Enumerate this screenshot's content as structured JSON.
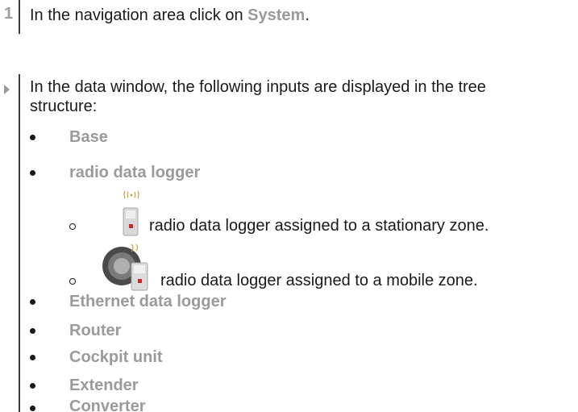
{
  "step": {
    "number": "1",
    "text_before": "In the navigation area click on ",
    "highlight": "System",
    "text_after": "."
  },
  "result": {
    "line1": "In the data window, the following inputs are displayed in the tree",
    "line2": "structure:"
  },
  "items": [
    {
      "label": "Base"
    },
    {
      "label": "radio data logger"
    }
  ],
  "sub_items": [
    {
      "icon": "radio-logger-stationary-icon",
      "text": "radio data logger assigned to a stationary zone."
    },
    {
      "icon": "radio-logger-mobile-icon",
      "text": "radio data logger assigned to a mobile zone."
    }
  ],
  "items_after": [
    {
      "label": "Ethernet data logger"
    },
    {
      "label": "Router"
    },
    {
      "label": "Cockpit unit"
    },
    {
      "label": "Extender"
    },
    {
      "label": "Converter"
    }
  ],
  "colors": {
    "highlight": "#9a9a9a",
    "text": "#1a1a1a",
    "rule": "#3d3d3d"
  }
}
